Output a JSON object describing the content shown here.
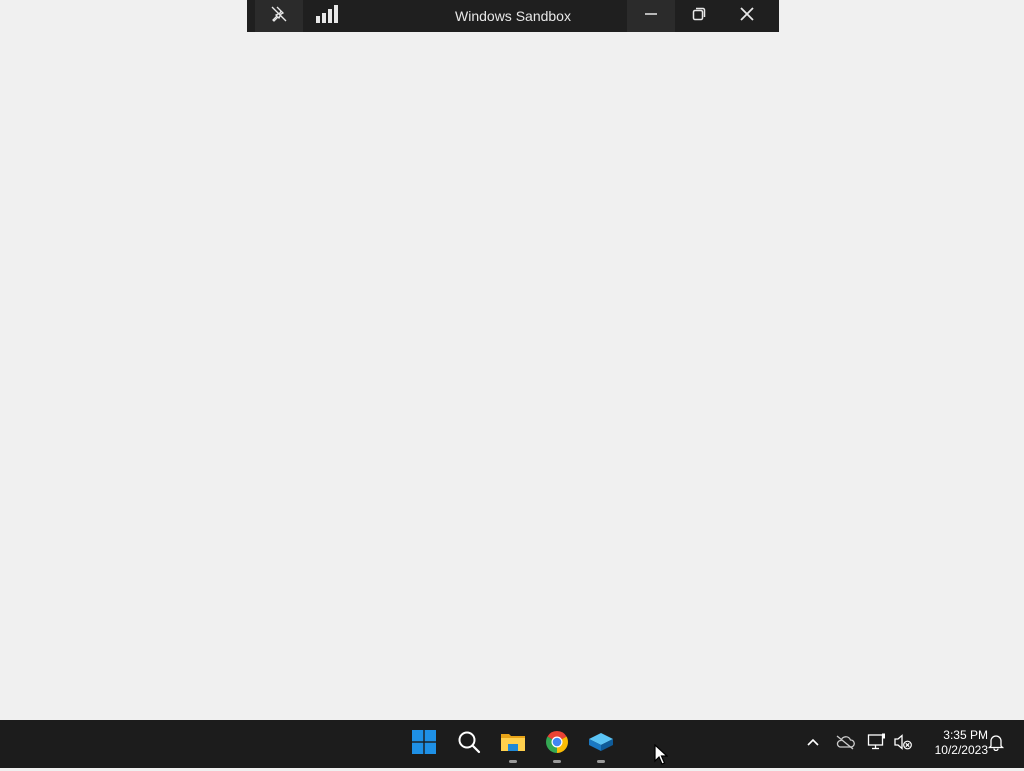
{
  "connection_bar": {
    "title": "Windows Sandbox",
    "icons": {
      "pin": "unpin-icon",
      "signal": "signal-bars-icon",
      "minimize": "minimize-icon",
      "restore": "restore-icon",
      "close": "close-icon"
    }
  },
  "taskbar": {
    "apps": [
      {
        "name": "start-button",
        "icon": "windows-logo-icon"
      },
      {
        "name": "search-button",
        "icon": "search-icon"
      },
      {
        "name": "file-explorer",
        "icon": "folder-icon",
        "running": true
      },
      {
        "name": "chrome",
        "icon": "chrome-icon",
        "running": true
      },
      {
        "name": "sandbox",
        "icon": "sandbox-icon",
        "running": true
      }
    ],
    "tray": {
      "icons": [
        "chevron-up-icon",
        "onedrive-offline-icon",
        "network-icon",
        "volume-muted-icon",
        "notification-bell-icon"
      ]
    },
    "clock": {
      "time": "3:35 PM",
      "date": "10/2/2023"
    }
  },
  "colors": {
    "desktop": "#f0f0f0",
    "taskbar": "#1c1c1c",
    "connection_bar": "#1f1f1f",
    "windows_blue": "#1e90e6"
  }
}
